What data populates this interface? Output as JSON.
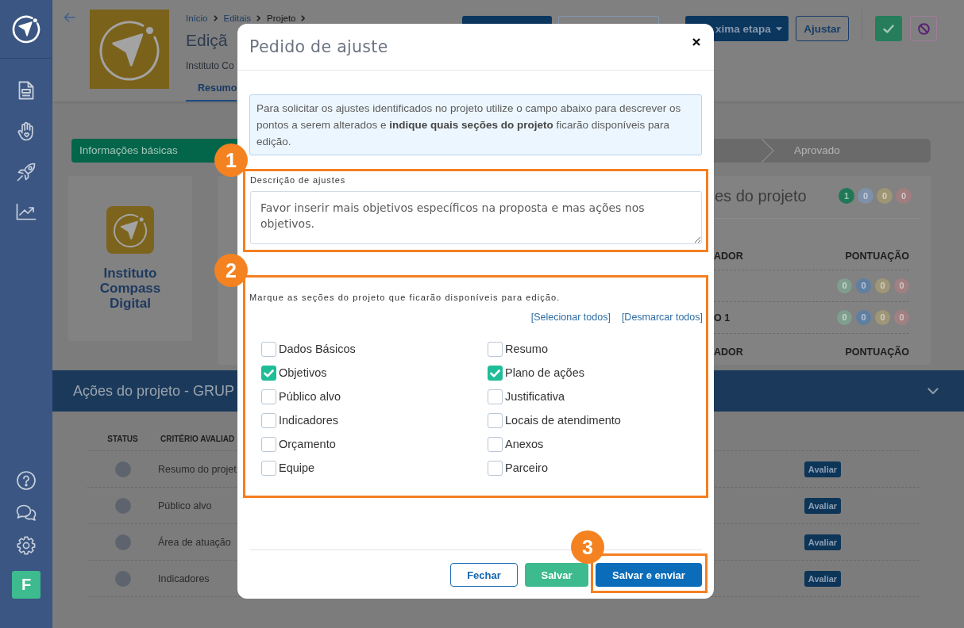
{
  "sidebar": {
    "avatar": "F"
  },
  "header": {
    "breadcrumb": [
      {
        "label": "Início",
        "current": false
      },
      {
        "label": "Editais",
        "current": false
      },
      {
        "label": "Projeto",
        "current": true
      }
    ],
    "title": "Ediçã",
    "subtitle": "Instituto Co",
    "tabs": [
      {
        "label": "Resumo",
        "selected": true
      }
    ],
    "covered_buttons": [
      {
        "kind": "primary"
      },
      {
        "kind": "outline"
      }
    ],
    "buttons": [
      {
        "label": "xima etapa",
        "kind": "dropdown"
      },
      {
        "label": "Ajustar",
        "kind": "outline"
      }
    ],
    "icon_buttons": [
      {
        "kind": "approve"
      },
      {
        "kind": "reject"
      }
    ]
  },
  "steps": [
    {
      "label": "Informações básicas",
      "completed": true
    },
    {
      "label": "Aprovado",
      "completed": false
    }
  ],
  "organization": {
    "name": "Instituto Compass Digital"
  },
  "evaluations": {
    "title": "es do projeto",
    "counts": [
      {
        "value": "1",
        "color": "#1f7857"
      },
      {
        "value": "0",
        "color": "#7d91aa"
      },
      {
        "value": "0",
        "color": "#9d9573"
      },
      {
        "value": "0",
        "color": "#a07d7f"
      }
    ],
    "blocks": [
      {
        "columns": [
          "ADOR",
          "PONTUAÇÃO"
        ],
        "rows": [
          {
            "counts": [
              {
                "value": "0",
                "color": "#7f9e8e"
              },
              {
                "value": "0",
                "color": "#5f7fa2"
              },
              {
                "value": "0",
                "color": "#9e9676"
              },
              {
                "value": "0",
                "color": "#a08081"
              }
            ]
          },
          {
            "label": "O 1",
            "counts": [
              {
                "value": "0",
                "color": "#7f9e8e"
              },
              {
                "value": "0",
                "color": "#5f7fa2"
              },
              {
                "value": "0",
                "color": "#9e9676"
              },
              {
                "value": "0",
                "color": "#a08081"
              }
            ]
          }
        ]
      },
      {
        "columns": [
          "ADOR",
          "PONTUAÇÃO"
        ]
      }
    ]
  },
  "actions_section": {
    "title": "Ações do projeto - GRUP",
    "columns": [
      "STATUS",
      "CRITÉRIO AVALIAD"
    ],
    "rows": [
      {
        "criterion": "Resumo do projet",
        "action": "Avaliar"
      },
      {
        "criterion": "Público alvo",
        "action": "Avaliar"
      },
      {
        "criterion": "Área de atuação",
        "action": "Avaliar"
      },
      {
        "criterion": "Indicadores",
        "action": "Avaliar"
      }
    ]
  },
  "modal": {
    "title": "Pedido de ajuste",
    "notice": "Para solicitar os ajustes identificados no projeto utilize o campo abaixo para descrever os pontos a serem alterados e **indique quais seções do projeto** ficarão disponíveis para edição.",
    "description": {
      "label": "Descrição de ajustes",
      "value": "Favor inserir mais objetivos específicos na proposta e mas ações nos objetivos."
    },
    "sections": {
      "instruction": "Marque as seções do projeto que ficarão disponíveis para edição.",
      "select_all": "[Selecionar todos]",
      "deselect_all": "[Desmarcar todos]",
      "items": [
        {
          "label": "Dados Básicos",
          "checked": false
        },
        {
          "label": "Resumo",
          "checked": false
        },
        {
          "label": "Objetivos",
          "checked": true
        },
        {
          "label": "Plano de ações",
          "checked": true
        },
        {
          "label": "Público alvo",
          "checked": false
        },
        {
          "label": "Justificativa",
          "checked": false
        },
        {
          "label": "Indicadores",
          "checked": false
        },
        {
          "label": "Locais de atendimento",
          "checked": false
        },
        {
          "label": "Orçamento",
          "checked": false
        },
        {
          "label": "Anexos",
          "checked": false
        },
        {
          "label": "Equipe",
          "checked": false
        },
        {
          "label": "Parceiro",
          "checked": false
        }
      ]
    },
    "buttons": [
      {
        "label": "Fechar",
        "kind": "outline"
      },
      {
        "label": "Salvar",
        "kind": "success"
      },
      {
        "label": "Salvar e enviar",
        "kind": "primary"
      }
    ]
  },
  "callouts": [
    {
      "number": "1"
    },
    {
      "number": "2"
    },
    {
      "number": "3"
    }
  ]
}
